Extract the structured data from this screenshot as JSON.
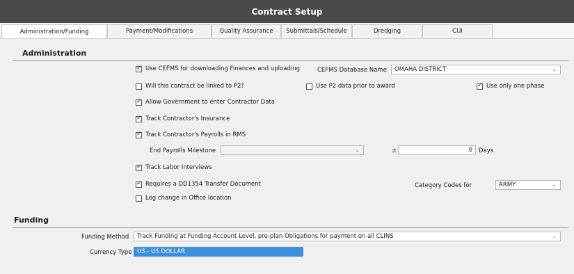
{
  "window": {
    "title": "Contract Setup"
  },
  "tabs": [
    {
      "label": "Administration/Funding",
      "active": true
    },
    {
      "label": "Payment/Modifications"
    },
    {
      "label": "Quality Assurance"
    },
    {
      "label": "Submittals/Schedule"
    },
    {
      "label": "Dredging"
    },
    {
      "label": "CUI"
    }
  ],
  "administration": {
    "title": "Administration",
    "use_cefms": {
      "label": "Use CEFMS for downloading Finances and uploading",
      "checked": true
    },
    "cefms_db_label": "CEFMS Database Name",
    "cefms_db_value": "OMAHA DISTRICT",
    "linked_p2": {
      "label": "Will this contract be linked to P2?",
      "checked": false
    },
    "use_p2_data": {
      "label": "Use P2 data prior to award",
      "checked": false
    },
    "one_phase": {
      "label": "Use only one phase",
      "checked": true
    },
    "allow_gov": {
      "label": "Allow Government to enter Contractor Data",
      "checked": true
    },
    "track_insurance": {
      "label": "Track Contractor's Insurance",
      "checked": true
    },
    "track_payrolls": {
      "label": "Track Contractor's Payrolls in RMS",
      "checked": true
    },
    "end_payrolls_label": "End Payrolls Milestone",
    "end_payrolls_value": "",
    "plus_minus": "±",
    "days_value": "0",
    "days_label": "Days",
    "track_labor": {
      "label": "Track Labor Interviews",
      "checked": true
    },
    "dd1354": {
      "label": "Requires a DD1354 Transfer Document",
      "checked": true
    },
    "category_label": "Category Codes for",
    "category_value": "ARMY",
    "log_office": {
      "label": "Log change in Office location",
      "checked": false
    }
  },
  "funding": {
    "title": "Funding",
    "method_label": "Funding Method",
    "method_value": "Track Funding at Funding Account Level, pre-plan Obligations for payment on all CLINS",
    "currency_label": "Currency Type",
    "currency_value": "US - US DOLLAR"
  },
  "icons": {
    "dropdown": "chevron-down-icon",
    "check": "checkmark-icon"
  }
}
